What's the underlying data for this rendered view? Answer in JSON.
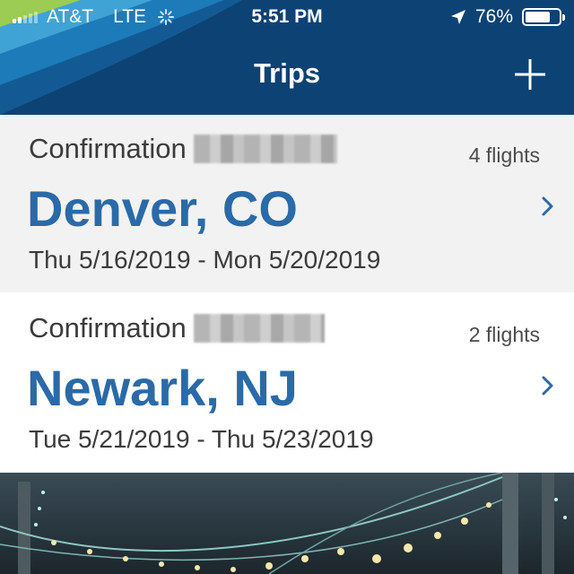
{
  "status_bar": {
    "carrier": "AT&T",
    "network": "LTE",
    "time": "5:51 PM",
    "battery_percent": "76%",
    "battery_level": 0.76,
    "icons": [
      "signal-icon",
      "loading-spinner-icon",
      "location-arrow-icon",
      "battery-icon"
    ]
  },
  "nav": {
    "title": "Trips",
    "add_icon": "plus-icon"
  },
  "trips": [
    {
      "confirmation_label": "Confirmation",
      "flights": "4 flights",
      "city": "Denver, CO",
      "dates": "Thu 5/16/2019 - Mon 5/20/2019"
    },
    {
      "confirmation_label": "Confirmation",
      "flights": "2 flights",
      "city": "Newark, NJ",
      "dates": "Tue 5/21/2019 - Thu 5/23/2019"
    }
  ],
  "colors": {
    "header_bg": "#0d4274",
    "accent_blue": "#2a6aa8",
    "card_gray": "#f2f2f2"
  }
}
